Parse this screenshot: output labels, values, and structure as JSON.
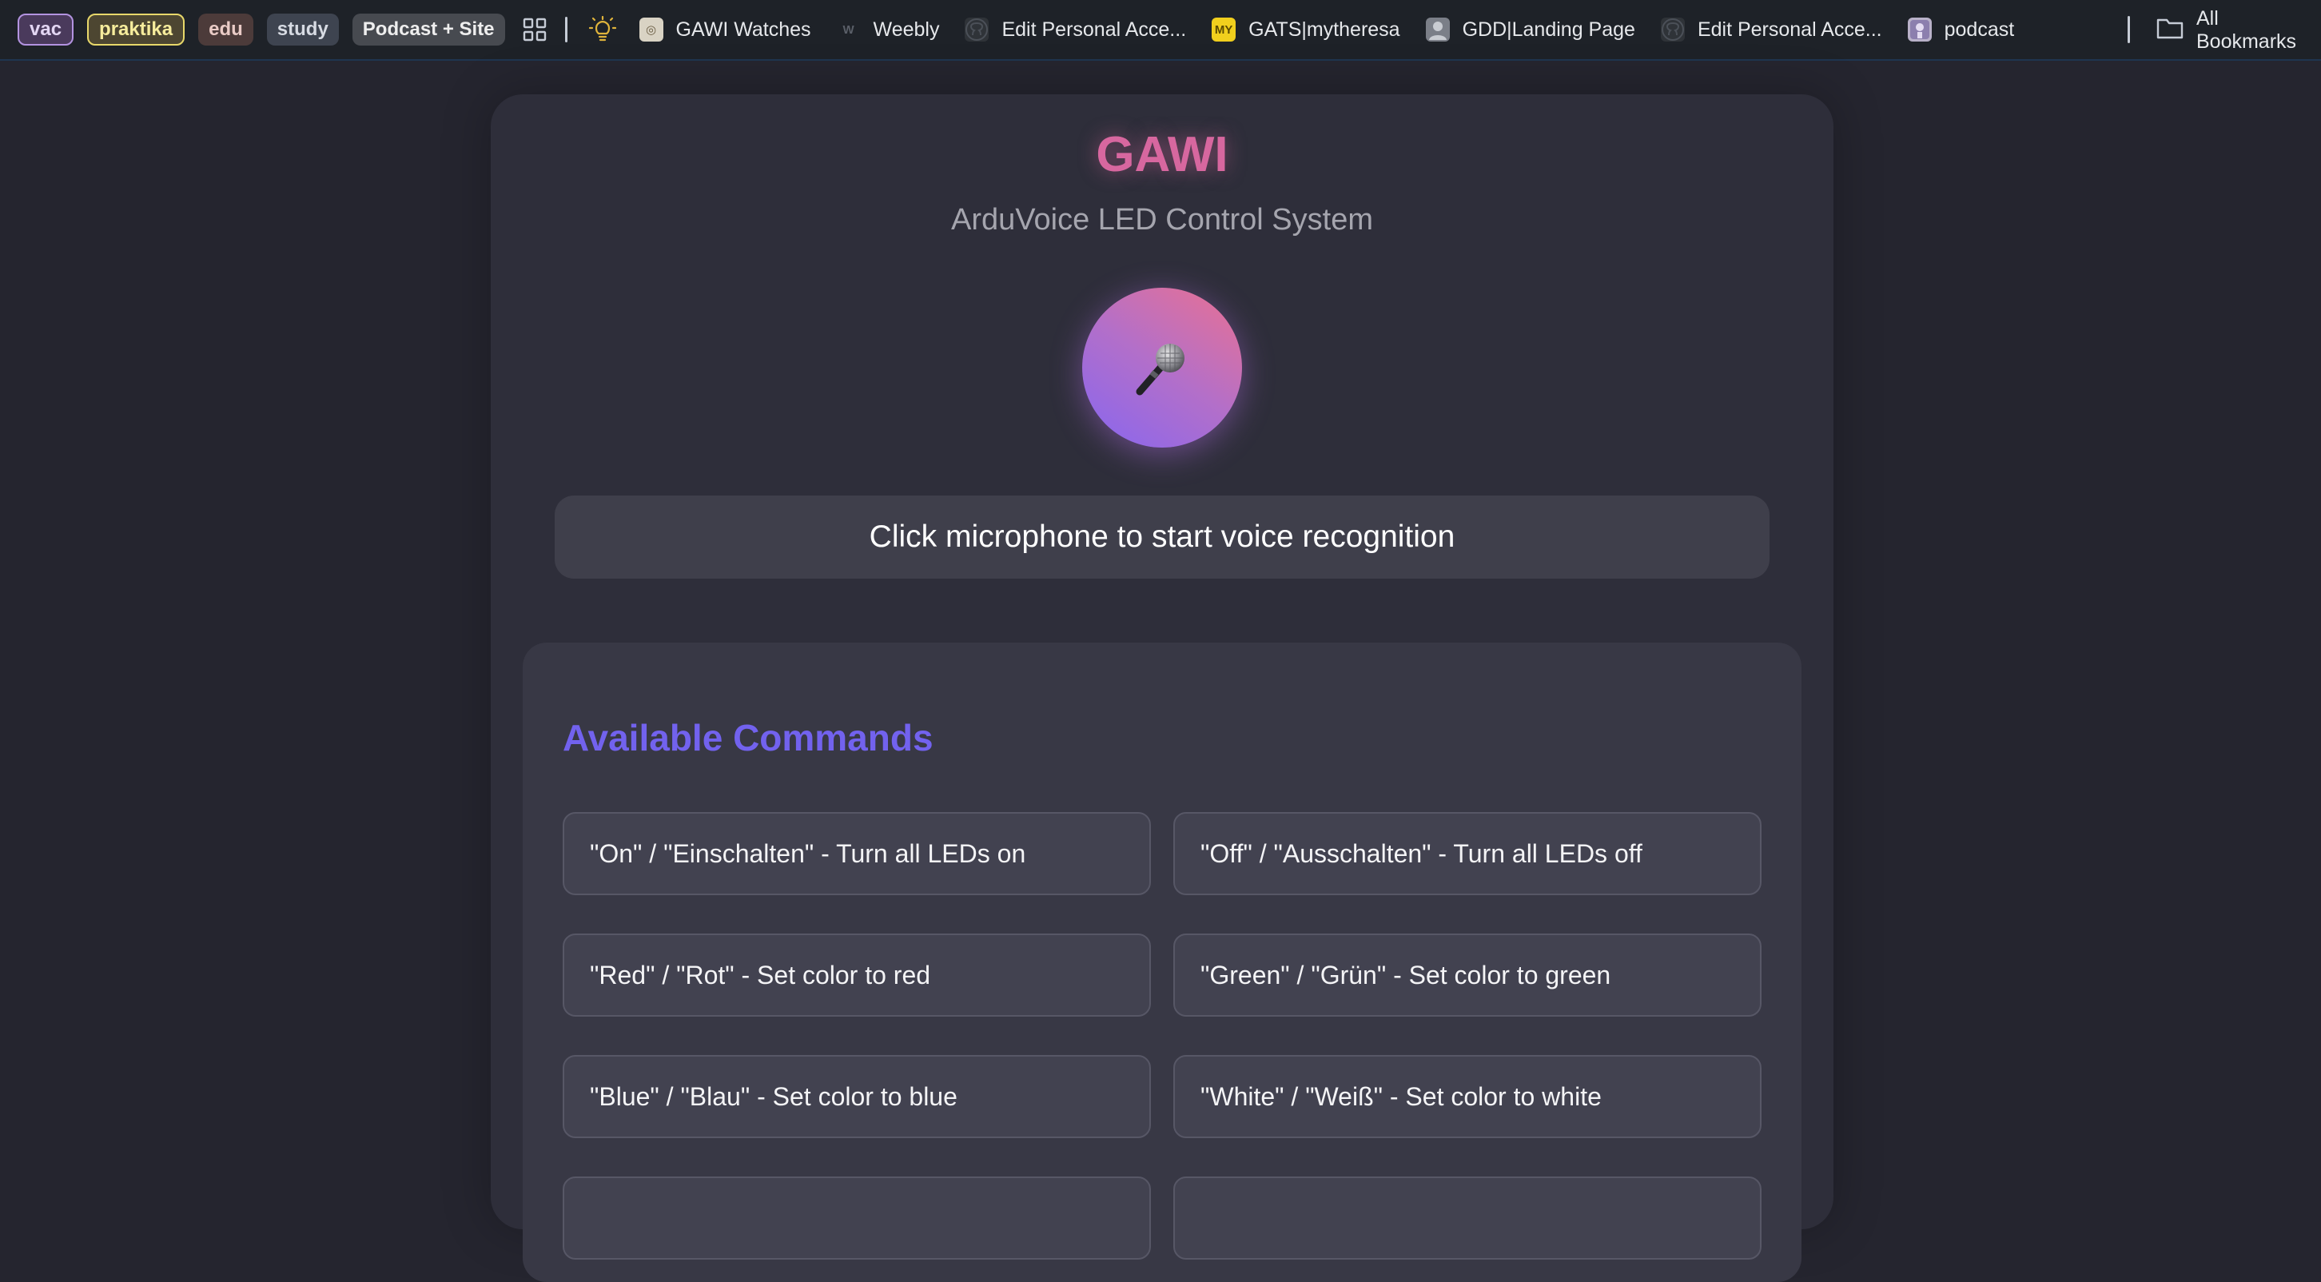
{
  "bookmarks_bar": {
    "groups": [
      {
        "label": "vac"
      },
      {
        "label": "praktika"
      },
      {
        "label": "edu"
      },
      {
        "label": "study"
      },
      {
        "label": "Podcast + Site"
      }
    ],
    "bookmarks": [
      {
        "label": "GAWI Watches",
        "icon": "watch-icon"
      },
      {
        "label": "Weebly",
        "icon": "weebly-icon"
      },
      {
        "label": "Edit Personal Acce...",
        "icon": "github-icon"
      },
      {
        "label": "GATS|mytheresa",
        "icon": "mytheresa-icon",
        "badge": "MY"
      },
      {
        "label": "GDD|Landing Page",
        "icon": "avatar-icon"
      },
      {
        "label": "Edit Personal Acce...",
        "icon": "github-icon"
      },
      {
        "label": "podcast",
        "icon": "podcast-icon"
      }
    ],
    "all_bookmarks_label": "All Bookmarks"
  },
  "app": {
    "title": "GAWI",
    "subtitle": "ArduVoice LED Control System",
    "mic_emoji": "🎤",
    "status": "Click microphone to start voice recognition",
    "colors": {
      "title": "#d7679f",
      "commands_title": "#7262ee",
      "mic_gradient_start": "#8766f0",
      "mic_gradient_end": "#ea7191"
    }
  },
  "commands": {
    "title": "Available Commands",
    "items": [
      "\"On\" / \"Einschalten\" - Turn all LEDs on",
      "\"Off\" / \"Ausschalten\" - Turn all LEDs off",
      "\"Red\" / \"Rot\" - Set color to red",
      "\"Green\" / \"Grün\" - Set color to green",
      "\"Blue\" / \"Blau\" - Set color to blue",
      "\"White\" / \"Weiß\" - Set color to white"
    ]
  }
}
